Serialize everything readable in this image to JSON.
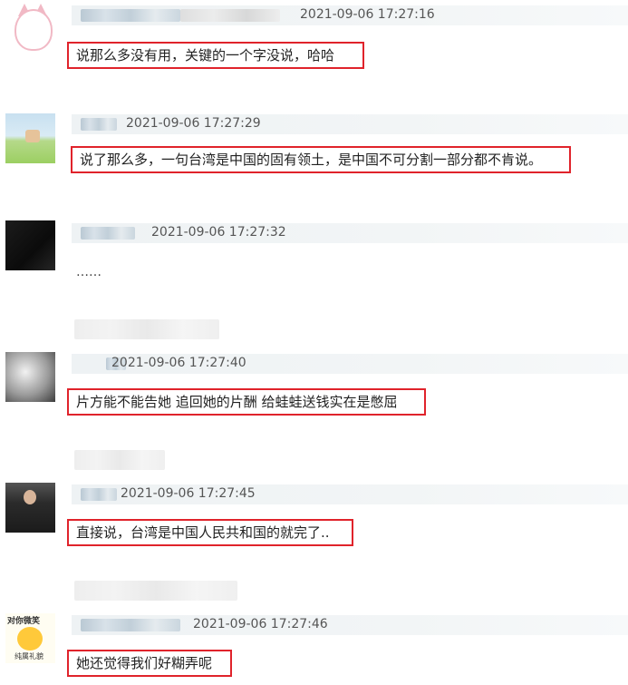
{
  "comments": [
    {
      "timestamp": "2021-09-06 17:27:16",
      "text": "说那么多没有用，关键的一个字没说，哈哈",
      "avatar": "pink-cat-avatar"
    },
    {
      "timestamp": "2021-09-06 17:27:29",
      "text": "说了那么多，一句台湾是中国的固有领土，是中国不可分割一部分都不肯说。",
      "avatar": "landscape-avatar"
    },
    {
      "timestamp": "2021-09-06 17:27:32",
      "text": "……",
      "avatar": "dark-avatar"
    },
    {
      "timestamp": "2021-09-06 17:27:40",
      "text": "片方能不能告她 追回她的片酬 给蛙蛙送钱实在是憋屈",
      "avatar": "bw-photo-avatar"
    },
    {
      "timestamp": "2021-09-06 17:27:45",
      "text": "直接说，台湾是中国人民共和国的就完了..",
      "avatar": "person-avatar"
    },
    {
      "timestamp": "2021-09-06 17:27:46",
      "text": "她还觉得我们好糊弄呢",
      "avatar": "emoji-avatar"
    }
  ],
  "avatar_badge": {
    "line1": "对你微笑",
    "line2": "纯属礼貌"
  },
  "colors": {
    "highlight_border": "#e0232b",
    "meta_bar": "#eef2f4",
    "blurred_name": "#c6d3dc"
  }
}
